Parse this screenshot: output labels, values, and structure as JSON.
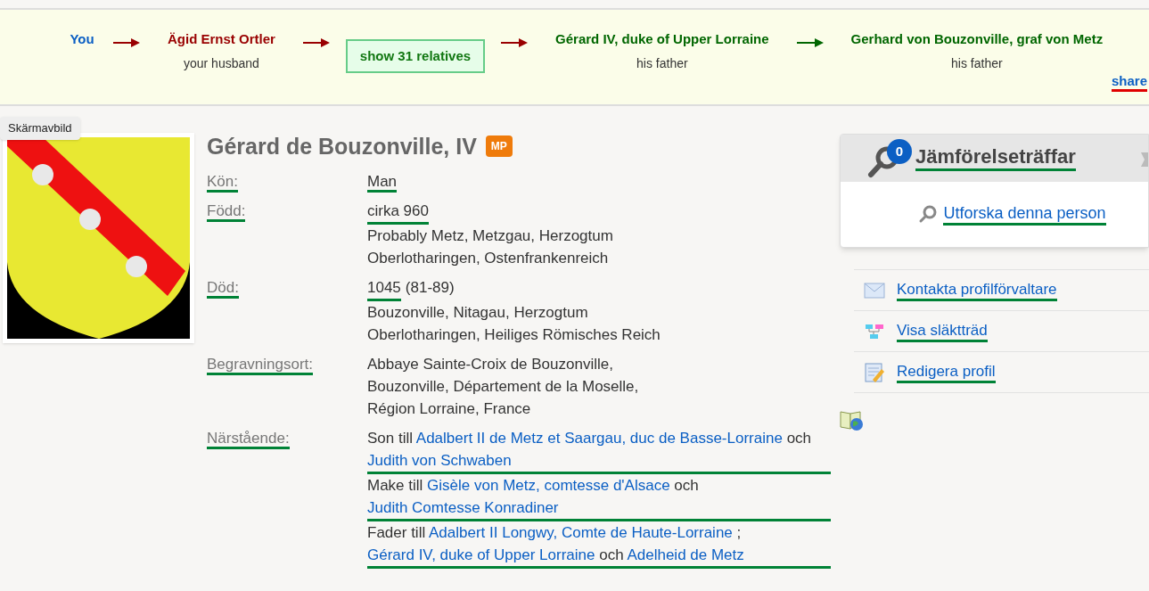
{
  "path": [
    {
      "kind": "you",
      "name": "You"
    },
    {
      "kind": "arrow",
      "color": "#990000"
    },
    {
      "kind": "person",
      "name": "Ägid Ernst Ortler",
      "relation": "your husband",
      "color": "#990000"
    },
    {
      "kind": "arrow",
      "color": "#990000"
    },
    {
      "kind": "button",
      "name": "show 31 relatives"
    },
    {
      "kind": "arrow",
      "color": "#990000"
    },
    {
      "kind": "person",
      "name": "Gérard IV, duke of Upper Lorraine",
      "relation": "his father",
      "color": "#006600"
    },
    {
      "kind": "arrow",
      "color": "#006600"
    },
    {
      "kind": "person",
      "name": "Gerhard von Bouzonville, graf von Metz",
      "relation": "his father",
      "color": "#006600"
    }
  ],
  "share": "share",
  "tooltip": "Skärmavbild",
  "profile": {
    "name": "Gérard de Bouzonville, IV",
    "badge": "MP",
    "facts": [
      {
        "kind": "plain",
        "label": "Kön:",
        "value": "Man"
      },
      {
        "kind": "event",
        "label": "Född:",
        "date": "cirka 960",
        "place": "Probably Metz, Metzgau, Herzogtum Oberlotharingen, Ostenfrankenreich"
      },
      {
        "kind": "event",
        "label": "Död:",
        "date": "1045",
        "age": "(81-89)",
        "place": "Bouzonville, Nitagau, Herzogtum Oberlotharingen, Heiliges Römisches Reich"
      },
      {
        "kind": "text",
        "label": "Begravningsort:",
        "value": "Abbaye Sainte-Croix de Bouzonville, Bouzonville, Département de la Moselle, Région Lorraine, France"
      },
      {
        "kind": "relatives",
        "label": "Närstående:",
        "groups": [
          {
            "parts": [
              {
                "kind": "text",
                "text": "Son till"
              },
              {
                "kind": "link",
                "text": "Adalbert II de Metz et Saargau, duc de Basse-Lorraine"
              },
              {
                "kind": "text",
                "text": "och"
              },
              {
                "kind": "link",
                "text": "Judith von Schwaben"
              }
            ]
          },
          {
            "parts": [
              {
                "kind": "text",
                "text": "Make till"
              },
              {
                "kind": "link",
                "text": "Gisèle von Metz, comtesse d'Alsace"
              },
              {
                "kind": "text",
                "text": "och"
              },
              {
                "kind": "link",
                "text": "Judith Comtesse Konradiner"
              }
            ]
          },
          {
            "parts": [
              {
                "kind": "text",
                "text": "Fader till"
              },
              {
                "kind": "link",
                "text": "Adalbert II Longwy, Comte de Haute-Lorraine"
              },
              {
                "kind": "text",
                "text": ";"
              },
              {
                "kind": "link",
                "text": "Gérard IV, duke of Upper Lorraine"
              },
              {
                "kind": "text",
                "text": "och"
              },
              {
                "kind": "link",
                "text": "Adelheid de Metz"
              }
            ]
          }
        ]
      }
    ]
  },
  "matches": {
    "count": "0",
    "title": "Jämförelseträffar",
    "explore": "Utforska denna person"
  },
  "actions": [
    {
      "kind": "mail",
      "label": "Kontakta profilförvaltare"
    },
    {
      "kind": "tree",
      "label": "Visa släktträd"
    },
    {
      "kind": "edit",
      "label": "Redigera profil"
    }
  ]
}
